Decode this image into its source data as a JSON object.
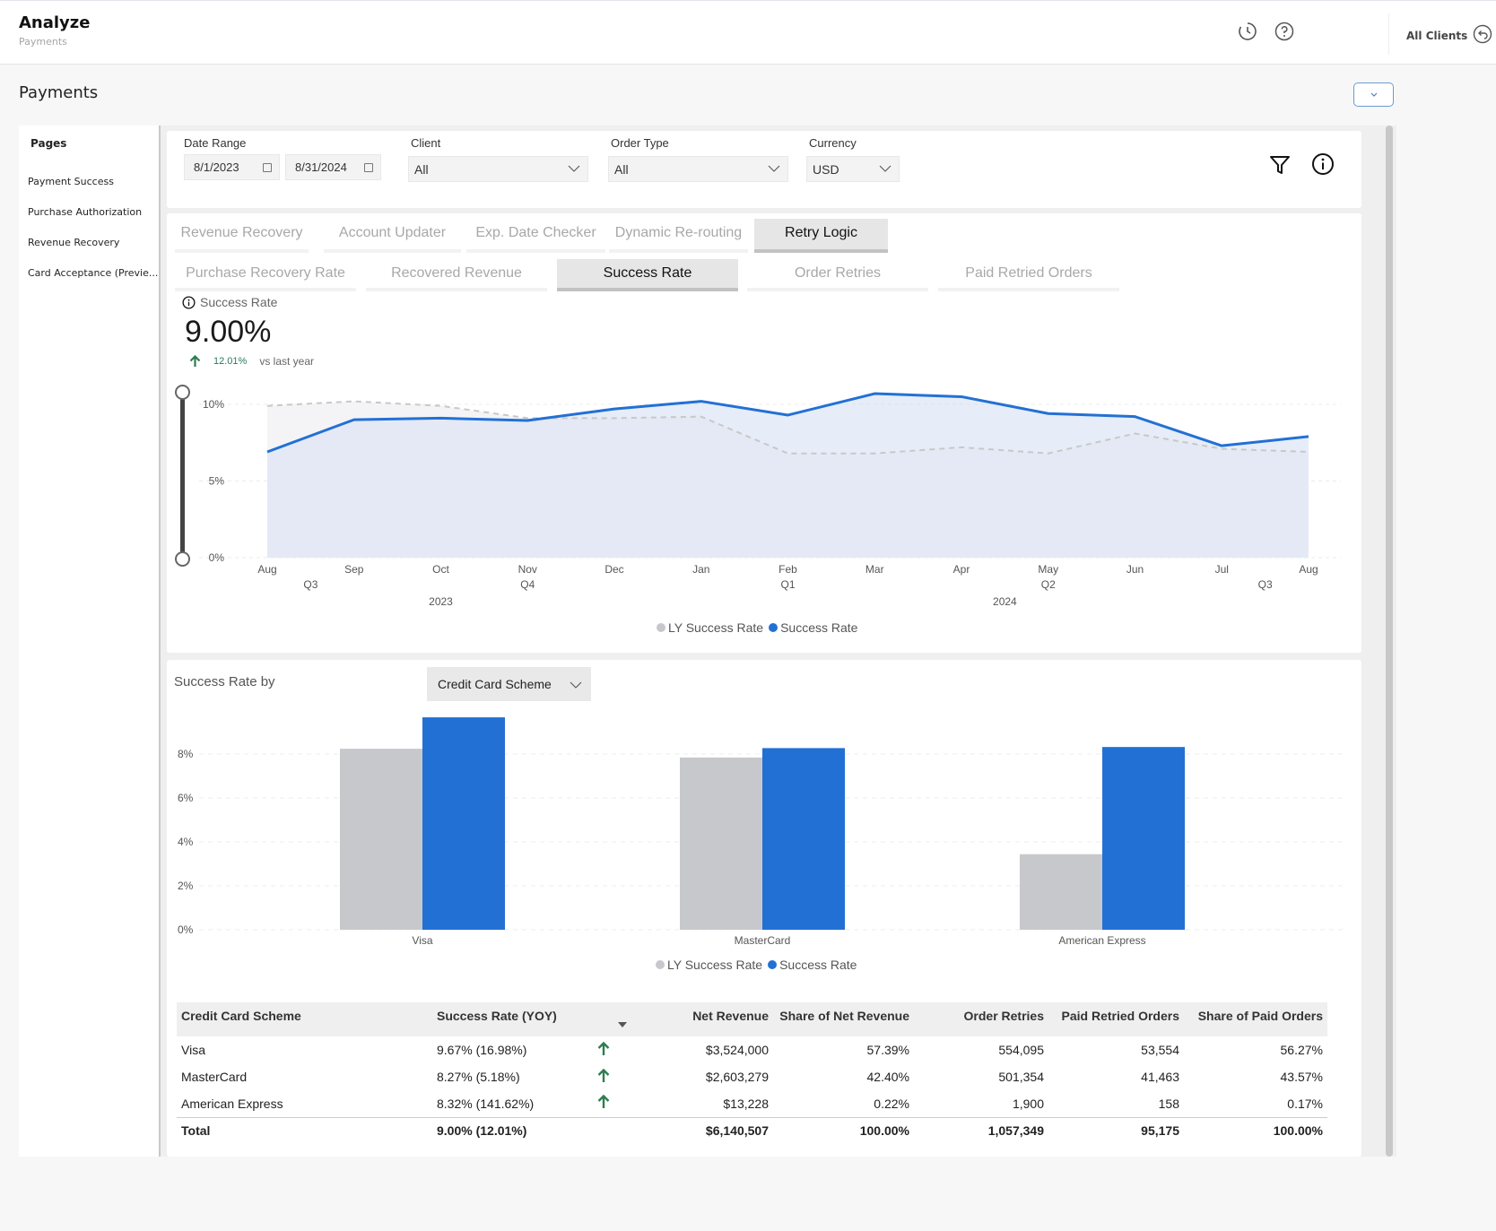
{
  "header": {
    "app_title": "Analyze",
    "app_subtitle": "Payments",
    "all_clients_label": "All Clients"
  },
  "page": {
    "title": "Payments"
  },
  "sidebar": {
    "heading": "Pages",
    "items": [
      {
        "label": "Payment Success"
      },
      {
        "label": "Purchase Authorization"
      },
      {
        "label": "Revenue Recovery"
      },
      {
        "label": "Card Acceptance (Previe..."
      }
    ]
  },
  "filters": {
    "date_range_label": "Date Range",
    "date_start": "8/1/2023",
    "date_end": "8/31/2024",
    "client_label": "Client",
    "client_value": "All",
    "order_type_label": "Order Type",
    "order_type_value": "All",
    "currency_label": "Currency",
    "currency_value": "USD"
  },
  "tabs_primary": [
    {
      "label": "Revenue Recovery",
      "active": false
    },
    {
      "label": "Account Updater",
      "active": false
    },
    {
      "label": "Exp. Date Checker",
      "active": false
    },
    {
      "label": "Dynamic Re-routing",
      "active": false
    },
    {
      "label": "Retry Logic",
      "active": true
    }
  ],
  "tabs_secondary": [
    {
      "label": "Purchase Recovery Rate",
      "active": false
    },
    {
      "label": "Recovered Revenue",
      "active": false
    },
    {
      "label": "Success Rate",
      "active": true
    },
    {
      "label": "Order Retries",
      "active": false
    },
    {
      "label": "Paid Retried Orders",
      "active": false
    }
  ],
  "kpi": {
    "label": "Success Rate",
    "value": "9.00%",
    "delta": "12.01%",
    "delta_direction": "up",
    "delta_suffix": "vs last year"
  },
  "colors": {
    "primary": "#2370d4",
    "ly": "#c6c8cc",
    "positive": "#2e7d4f"
  },
  "chart_data": [
    {
      "type": "area",
      "title": "Success Rate",
      "x": [
        "Aug",
        "Sep",
        "Oct",
        "Nov",
        "Dec",
        "Jan",
        "Feb",
        "Mar",
        "Apr",
        "May",
        "Jun",
        "Jul",
        "Aug"
      ],
      "quarter_labels": [
        {
          "index": 0.5,
          "label": "Q3"
        },
        {
          "index": 3,
          "label": "Q4"
        },
        {
          "index": 6,
          "label": "Q1"
        },
        {
          "index": 9,
          "label": "Q2"
        },
        {
          "index": 11.5,
          "label": "Q3"
        }
      ],
      "year_labels": [
        {
          "index": 2,
          "label": "2023"
        },
        {
          "index": 8.5,
          "label": "2024"
        }
      ],
      "series": [
        {
          "name": "LY Success Rate",
          "style": "dashed",
          "values": [
            9.9,
            10.2,
            9.9,
            9.1,
            9.1,
            9.2,
            6.8,
            6.8,
            7.2,
            6.8,
            8.1,
            7.1,
            6.9
          ]
        },
        {
          "name": "Success Rate",
          "style": "solid",
          "values": [
            6.9,
            9.0,
            9.1,
            8.95,
            9.7,
            10.2,
            9.3,
            10.7,
            10.5,
            9.4,
            9.2,
            7.3,
            7.9
          ]
        }
      ],
      "yticks": [
        "0%",
        "5%",
        "10%"
      ],
      "ylim": [
        0,
        10
      ],
      "xlabel": "",
      "ylabel": "",
      "grid": true,
      "legend": "bottom-center"
    },
    {
      "type": "bar",
      "title": "Success Rate by",
      "categories": [
        "Visa",
        "MasterCard",
        "American Express"
      ],
      "series": [
        {
          "name": "LY Success Rate",
          "values": [
            8.24,
            7.84,
            3.44
          ]
        },
        {
          "name": "Success Rate",
          "values": [
            9.67,
            8.27,
            8.32
          ]
        }
      ],
      "yticks": [
        "0%",
        "2%",
        "4%",
        "6%",
        "8%"
      ],
      "ylim": [
        0,
        8
      ],
      "xlabel": "",
      "ylabel": "",
      "grid": true,
      "legend": "bottom-center"
    }
  ],
  "breakdown": {
    "title": "Success Rate by",
    "dimension_value": "Credit Card Scheme"
  },
  "table": {
    "columns": [
      "Credit Card Scheme",
      "Success Rate (YOY)",
      "",
      "Net Revenue",
      "Share of Net Revenue",
      "Order Retries",
      "Paid Retried Orders",
      "Share of Paid Orders"
    ],
    "rows": [
      {
        "scheme": "Visa",
        "rate": "9.67% (16.98%)",
        "trend": "up",
        "net_revenue": "$3,524,000",
        "share_net": "57.39%",
        "retries": "554,095",
        "paid_retried": "53,554",
        "share_paid": "56.27%"
      },
      {
        "scheme": "MasterCard",
        "rate": "8.27% (5.18%)",
        "trend": "up",
        "net_revenue": "$2,603,279",
        "share_net": "42.40%",
        "retries": "501,354",
        "paid_retried": "41,463",
        "share_paid": "43.57%"
      },
      {
        "scheme": "American Express",
        "rate": "8.32% (141.62%)",
        "trend": "up",
        "net_revenue": "$13,228",
        "share_net": "0.22%",
        "retries": "1,900",
        "paid_retried": "158",
        "share_paid": "0.17%"
      }
    ],
    "total": {
      "scheme": "Total",
      "rate": "9.00% (12.01%)",
      "net_revenue": "$6,140,507",
      "share_net": "100.00%",
      "retries": "1,057,349",
      "paid_retried": "95,175",
      "share_paid": "100.00%"
    }
  },
  "icons": {
    "history": "history-icon",
    "help": "help-icon",
    "back": "back-arrow-icon",
    "filter": "filter-icon",
    "info": "info-icon",
    "calendar": "calendar-icon",
    "chevron": "chevron-down-icon",
    "trend_up": "arrow-up-icon"
  }
}
